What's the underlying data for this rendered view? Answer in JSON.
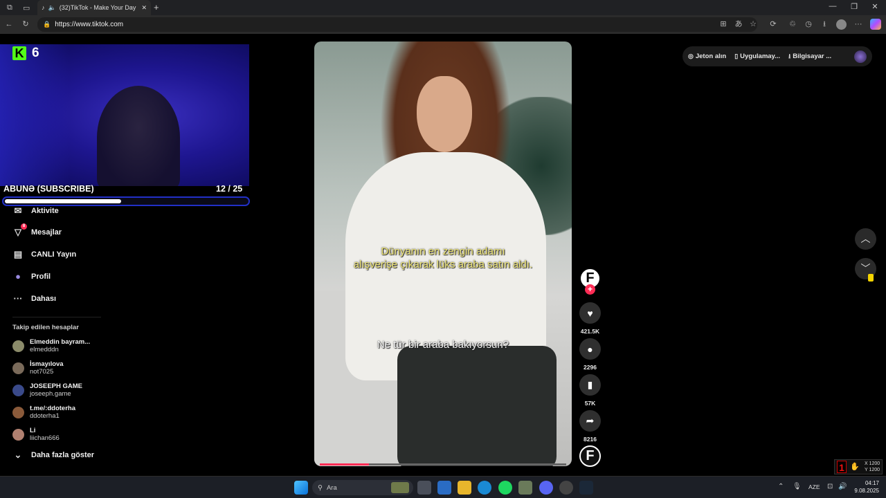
{
  "browser": {
    "tab_title": "(32)TikTok - Make Your Day",
    "url": "https://www.tiktok.com",
    "minimize": "—",
    "maximize": "❐",
    "close": "✕",
    "tab_close": "✕",
    "new_tab": "+"
  },
  "overlay": {
    "kick_logo": "K",
    "kick_count": "6",
    "subscribe_label": "ABUNƏ (SUBSCRIBE)",
    "subscribe_count": "12  / 25",
    "subscribe_progress": 0.48
  },
  "sidebar": {
    "nav": [
      {
        "label": "Aktivite",
        "icon": "✉"
      },
      {
        "label": "Mesajlar",
        "icon": "▽",
        "badge": "8"
      },
      {
        "label": "CANLI Yayın",
        "icon": "▤"
      },
      {
        "label": "Profil",
        "icon": "●"
      },
      {
        "label": "Dahası",
        "icon": "···"
      }
    ],
    "following_title": "Takip edilen hesaplar",
    "accounts": [
      {
        "name": "Elmeddin bayram...",
        "handle": "elmedddn",
        "color": "#8b8b6a"
      },
      {
        "name": "İsmayılova",
        "handle": "not7025",
        "color": "#7a6a5a"
      },
      {
        "name": "JOSEEPH GAME",
        "handle": "joseeph.game",
        "color": "#3a4a8a"
      },
      {
        "name": "t.me/:ddoterha",
        "handle": "ddoterha1",
        "color": "#8a5a3a"
      },
      {
        "name": "Li",
        "handle": "liichan666",
        "color": "#b08070"
      }
    ],
    "show_more": "Daha fazla göster"
  },
  "video": {
    "caption_line1": "Dünyanın en zengin adamı",
    "caption_line2": "alışverişe çıkarak lüks araba satın aldı.",
    "caption_line3": "Ne tür bir araba bakıyorsun?",
    "progress": 0.2
  },
  "actions": {
    "creator_initial": "F",
    "follow_plus": "+",
    "likes": "421.5K",
    "comments": "2296",
    "saves": "57K",
    "shares": "8216",
    "sound_initial": "F"
  },
  "topbar": {
    "coins": "Jeton alın",
    "app": "Uygulamay...",
    "desktop": "Bilgisayar ..."
  },
  "mini_overlay": {
    "number": "1",
    "x": "X 1200",
    "y": "Y 1200"
  },
  "taskbar": {
    "search_placeholder": "Ara",
    "lang": "AZE",
    "time": "04:17",
    "date": "9.08.2025"
  },
  "colors": {
    "accent": "#fe2c55",
    "kick_green": "#53fc18",
    "caption_yellow": "#f1e878"
  }
}
